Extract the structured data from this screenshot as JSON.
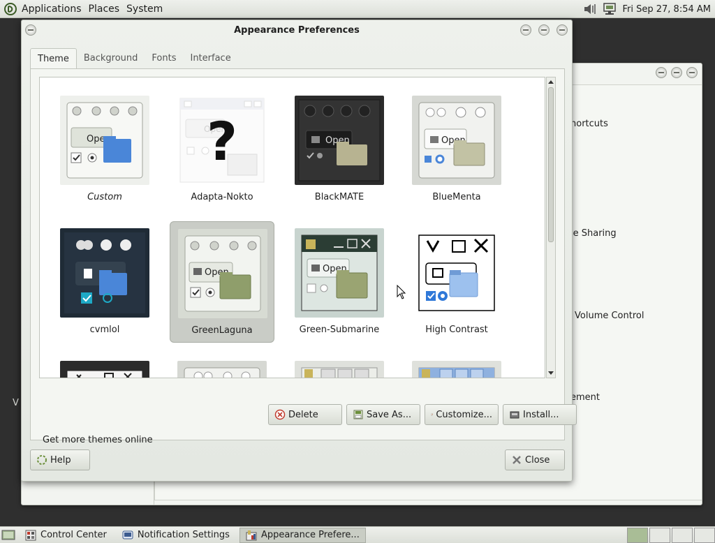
{
  "top_panel": {
    "menu": [
      "Applications",
      "Places",
      "System"
    ],
    "clock": "Fri Sep 27,  8:54 AM"
  },
  "background_window": {
    "items": [
      "hortcuts",
      "le Sharing",
      "Volume Control",
      "ement"
    ],
    "left_text": "V"
  },
  "dialog": {
    "title": "Appearance Preferences",
    "tabs": [
      "Theme",
      "Background",
      "Fonts",
      "Interface"
    ],
    "active_tab": "Theme",
    "themes": [
      {
        "name": "Custom",
        "italic": true
      },
      {
        "name": "Adapta-Nokto"
      },
      {
        "name": "BlackMATE"
      },
      {
        "name": "BlueMenta"
      },
      {
        "name": "cvmlol"
      },
      {
        "name": "GreenLaguna",
        "selected": true
      },
      {
        "name": "Green-Submarine"
      },
      {
        "name": "High Contrast"
      }
    ],
    "thumb_open_label": "Open",
    "buttons": {
      "delete": "Delete",
      "save_as": "Save As...",
      "customize": "Customize...",
      "install": "Install..."
    },
    "more_themes": "Get more themes online",
    "help": "Help",
    "close": "Close"
  },
  "taskbar": {
    "tasks": [
      {
        "label": "Control Center"
      },
      {
        "label": "Notification Settings"
      },
      {
        "label": "Appearance Prefere...",
        "active": true
      }
    ]
  }
}
